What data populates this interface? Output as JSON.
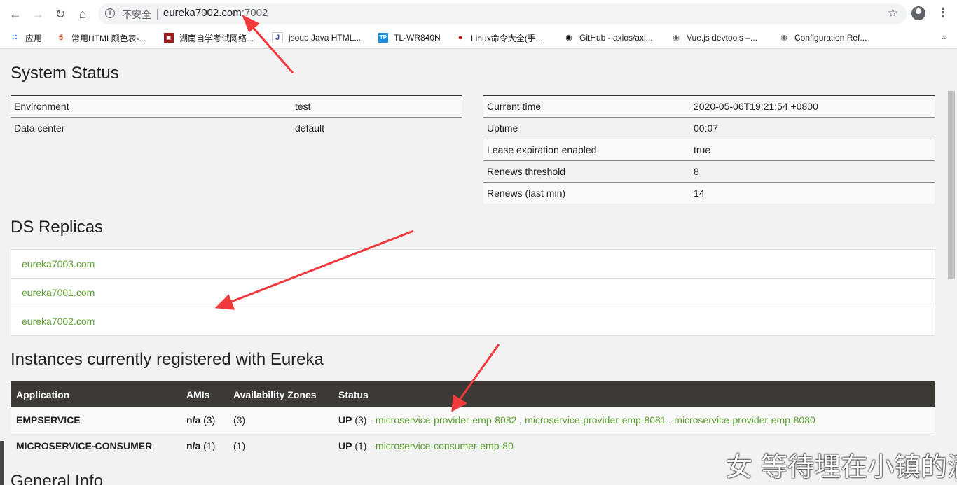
{
  "browser": {
    "security_label": "不安全",
    "url_host": "eureka7002.com",
    "url_port": ":7002",
    "bookmarks": [
      {
        "icon": "apps-grid-icon",
        "label": "应用"
      },
      {
        "icon": "html5-icon",
        "label": "常用HTML颜色表-..."
      },
      {
        "icon": "site-icon",
        "label": "湖南自学考试网络..."
      },
      {
        "icon": "jsoup-icon",
        "label": "jsoup Java HTML..."
      },
      {
        "icon": "tplink-icon",
        "label": "TL-WR840N"
      },
      {
        "icon": "redhat-icon",
        "label": "Linux命令大全(手..."
      },
      {
        "icon": "github-icon",
        "label": "GitHub - axios/axi..."
      },
      {
        "icon": "globe-icon",
        "label": "Vue.js devtools –..."
      },
      {
        "icon": "globe-icon",
        "label": "Configuration Ref..."
      }
    ]
  },
  "system_status": {
    "title": "System Status",
    "left": [
      {
        "key": "Environment",
        "value": "test"
      },
      {
        "key": "Data center",
        "value": "default"
      }
    ],
    "right": [
      {
        "key": "Current time",
        "value": "2020-05-06T19:21:54 +0800"
      },
      {
        "key": "Uptime",
        "value": "00:07"
      },
      {
        "key": "Lease expiration enabled",
        "value": "true"
      },
      {
        "key": "Renews threshold",
        "value": "8"
      },
      {
        "key": "Renews (last min)",
        "value": "14"
      }
    ]
  },
  "ds_replicas": {
    "title": "DS Replicas",
    "items": [
      "eureka7003.com",
      "eureka7001.com",
      "eureka7002.com"
    ]
  },
  "instances": {
    "title": "Instances currently registered with Eureka",
    "headers": [
      "Application",
      "AMIs",
      "Availability Zones",
      "Status"
    ],
    "rows": [
      {
        "application": "EMPSERVICE",
        "amis_na": "n/a",
        "amis_count": "(3)",
        "zones": "(3)",
        "status": "UP",
        "status_count": "(3) -",
        "links": [
          "microservice-provider-emp-8082",
          "microservice-provider-emp-8081",
          "microservice-provider-emp-8080"
        ]
      },
      {
        "application": "MICROSERVICE-CONSUMER",
        "amis_na": "n/a",
        "amis_count": "(1)",
        "zones": "(1)",
        "status": "UP",
        "status_count": "(1) -",
        "links": [
          "microservice-consumer-emp-80"
        ]
      }
    ]
  },
  "general_info": {
    "title": "General Info"
  },
  "watermark": {
    "text": "女  等待埋在小镇的满"
  },
  "colors": {
    "link": "#5fa134",
    "header_bg": "#3d3a35",
    "arrow": "#f0393c",
    "page_bg": "#f2f2f2"
  }
}
